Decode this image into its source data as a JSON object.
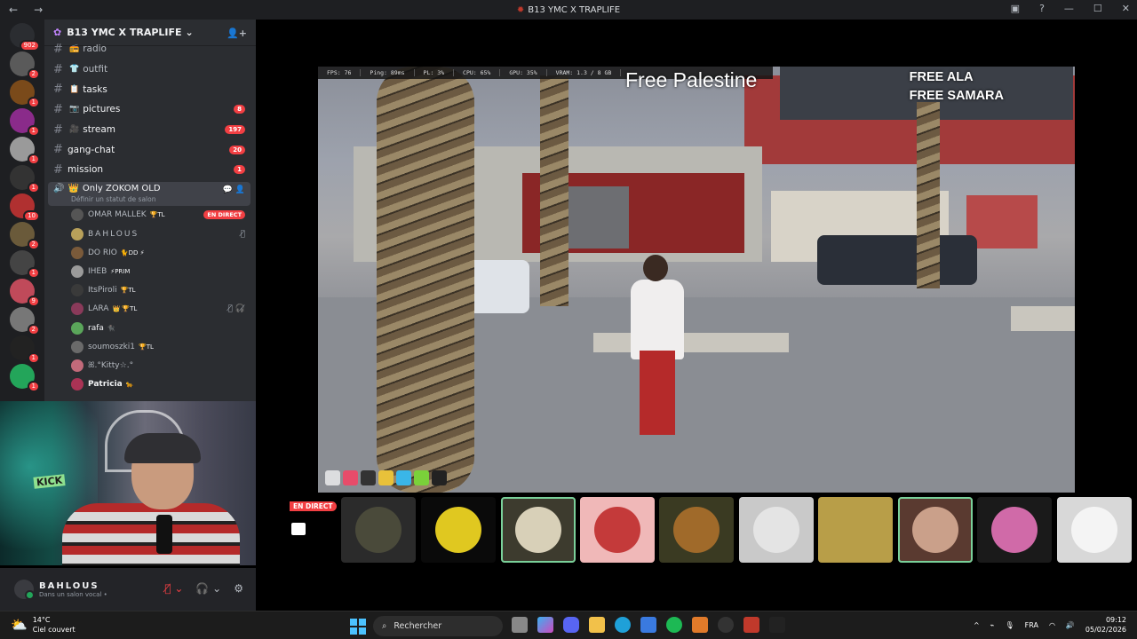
{
  "window": {
    "title": "B13 YMC X TRAPLIFE"
  },
  "server": {
    "name": "B13 YMC X TRAPLIFE"
  },
  "guild_badges": [
    "902",
    "2",
    "1",
    "1",
    "1",
    "1",
    "10",
    "2",
    "1",
    "9",
    "2",
    "1",
    "1"
  ],
  "channels": [
    {
      "name": "radio",
      "emoji": "📻",
      "count": ""
    },
    {
      "name": "outfit",
      "emoji": "👕",
      "count": ""
    },
    {
      "name": "tasks",
      "emoji": "📋",
      "count": ""
    },
    {
      "name": "pictures",
      "emoji": "📷",
      "count": "8"
    },
    {
      "name": "stream",
      "emoji": "🎥",
      "count": "197"
    },
    {
      "name": "gang-chat",
      "emoji": "",
      "count": "20"
    },
    {
      "name": "mission",
      "emoji": "",
      "count": "1"
    }
  ],
  "voice": {
    "name": "Only ZOKOM OLD",
    "status": "Définir un statut de salon",
    "live_label": "EN DIRECT",
    "users": [
      {
        "name": "OMAR MALLEK",
        "tag": "🏆TL",
        "live": true
      },
      {
        "name": "BAHLOUS",
        "tag": "",
        "live": false
      },
      {
        "name": "DO RIO",
        "tag": "🐈DD ⚡",
        "live": false
      },
      {
        "name": "IHEB",
        "tag": "⚡PRIM",
        "live": false
      },
      {
        "name": "ItsPiroli",
        "tag": "🏆TL",
        "live": false
      },
      {
        "name": "LARA",
        "tag": "👑 🏆TL",
        "live": false
      },
      {
        "name": "rafa",
        "tag": "🐈‍⬛",
        "live": false
      },
      {
        "name": "soumoszki1",
        "tag": "🏆TL",
        "live": false
      },
      {
        "name": "ꕤ.°Kitty☆.°",
        "tag": "",
        "live": false
      },
      {
        "name": "Patricia",
        "tag": "🐆",
        "live": false
      }
    ]
  },
  "user_panel": {
    "name": "BAHLOUS",
    "status": "Dans un salon vocal •"
  },
  "game": {
    "hud": [
      "FPS: 76",
      "Ping: 89ms",
      "PL: 3%",
      "CPU: 65%",
      "GPU: 35%",
      "VRAM: 1.3 / 8 GB"
    ],
    "overlay_center": "Free Palestine",
    "overlay_right_1": "FREE ALA",
    "overlay_right_2": "FREE SAMARA"
  },
  "tiles": {
    "live_label": "EN DIRECT"
  },
  "taskbar": {
    "temperature": "14°C",
    "weather": "Ciel couvert",
    "search_placeholder": "Rechercher",
    "language": "FRA",
    "time": "09:12",
    "date": "05/02/2026"
  },
  "colors": {
    "accent": "#5865f2",
    "danger": "#f23f43",
    "online": "#23a55a"
  }
}
